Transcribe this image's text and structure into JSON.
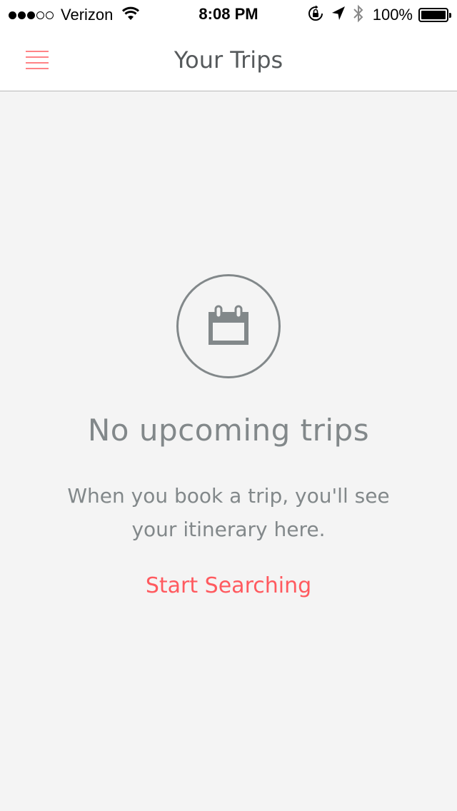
{
  "status_bar": {
    "signal": {
      "full": 3,
      "total": 5
    },
    "carrier": "Verizon",
    "time": "8:08 PM",
    "battery_percent": "100%",
    "icons": [
      "wifi-icon",
      "orientation-lock-icon",
      "location-arrow-icon",
      "bluetooth-icon",
      "battery-icon"
    ]
  },
  "nav": {
    "title": "Your Trips",
    "menu_icon": "hamburger-menu-icon"
  },
  "empty_state": {
    "icon": "calendar-icon",
    "title": "No upcoming trips",
    "message": "When you book a trip, you'll see your itinerary here.",
    "action_label": "Start Searching"
  },
  "colors": {
    "accent": "#ff5a5f",
    "muted_text": "#82888a",
    "title_text": "#565a5c",
    "background": "#f4f4f4",
    "nav_background": "#ffffff"
  }
}
